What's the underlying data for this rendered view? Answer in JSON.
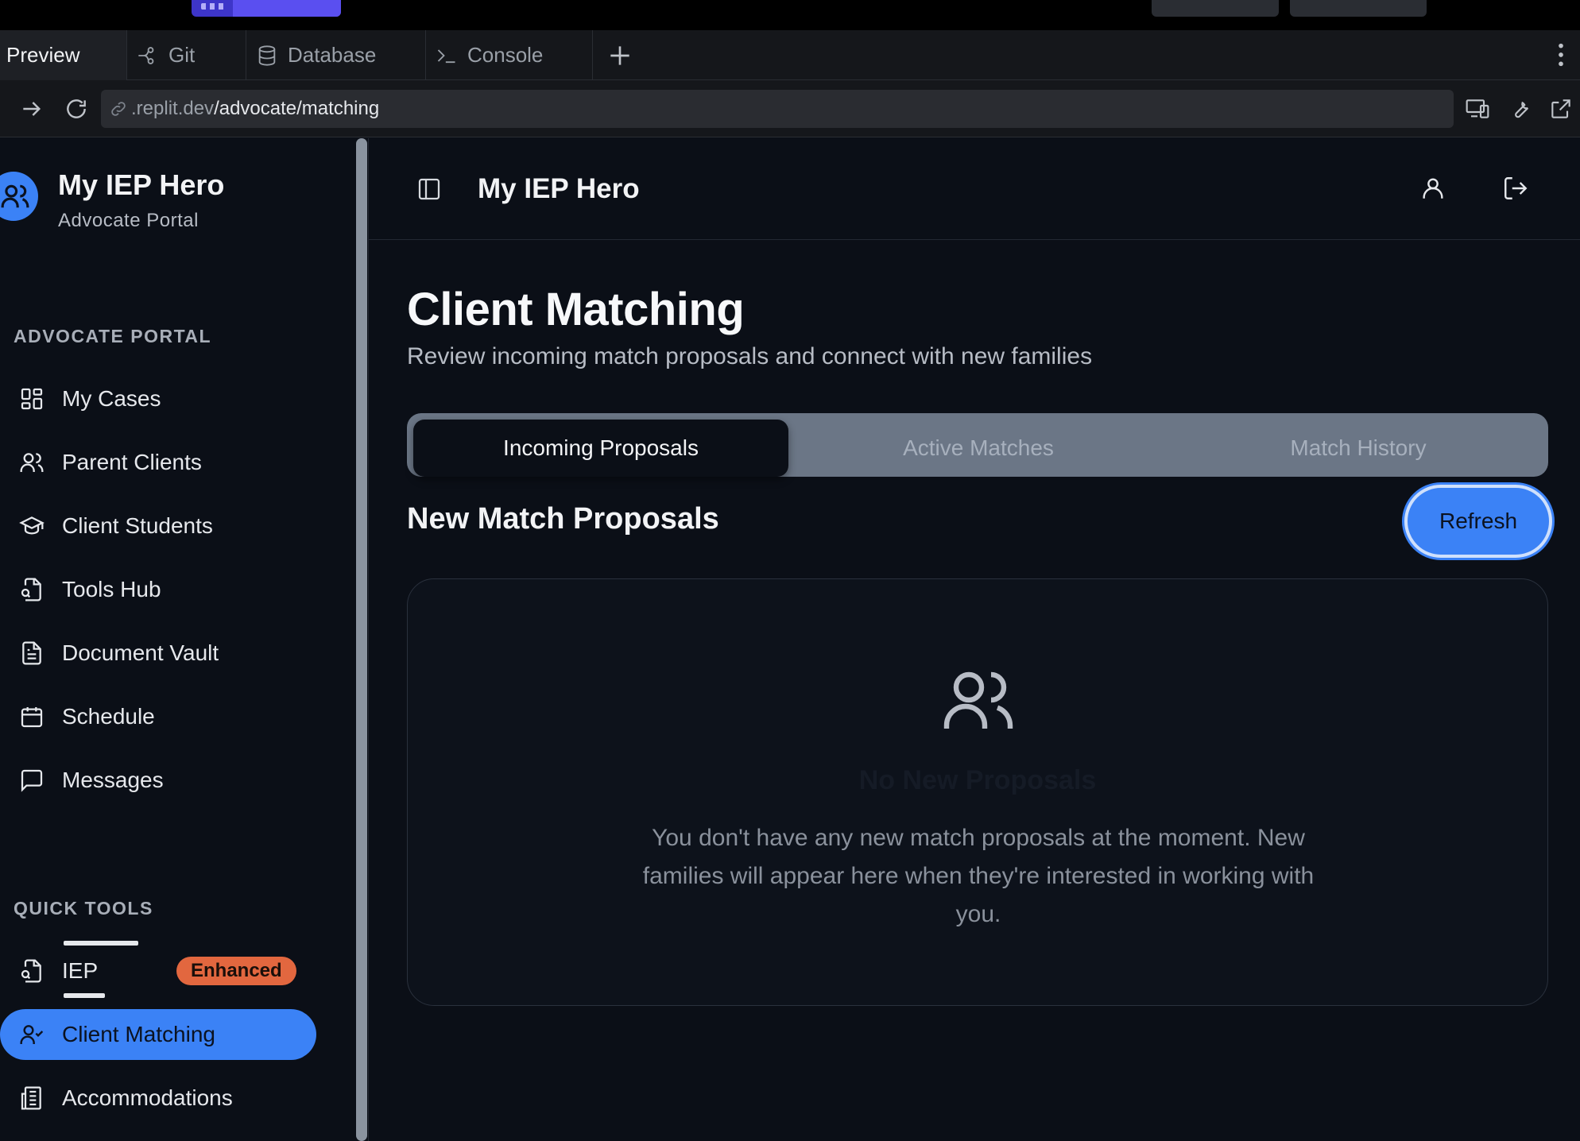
{
  "browser": {
    "tabs": [
      {
        "label": "Preview",
        "icon": "preview"
      },
      {
        "label": "Git",
        "icon": "git-icon"
      },
      {
        "label": "Database",
        "icon": "database-icon"
      },
      {
        "label": "Console",
        "icon": "console-icon"
      }
    ],
    "url_host": ".replit.dev",
    "url_path": "/advocate/matching"
  },
  "sidebar": {
    "brand_title": "My IEP Hero",
    "brand_subtitle": "Advocate Portal",
    "section_primary": "ADVOCATE PORTAL",
    "primary_items": [
      {
        "label": "My Cases",
        "icon": "layout-grid-icon"
      },
      {
        "label": "Parent Clients",
        "icon": "users-icon"
      },
      {
        "label": "Client Students",
        "icon": "graduation-cap-icon"
      },
      {
        "label": "Tools Hub",
        "icon": "file-search-icon"
      },
      {
        "label": "Document Vault",
        "icon": "file-text-icon"
      },
      {
        "label": "Schedule",
        "icon": "calendar-icon"
      },
      {
        "label": "Messages",
        "icon": "message-square-icon"
      }
    ],
    "section_tools": "QUICK TOOLS",
    "tool_items": [
      {
        "label": "IEP",
        "icon": "file-search-icon",
        "badge": "Enhanced"
      },
      {
        "label": "Client Matching",
        "icon": "user-check-icon",
        "active": true
      },
      {
        "label": "Accommodations",
        "icon": "building-icon"
      }
    ]
  },
  "header": {
    "title": "My IEP Hero"
  },
  "main": {
    "title": "Client Matching",
    "subtitle": "Review incoming match proposals and connect with new families",
    "tabs": [
      {
        "label": "Incoming Proposals",
        "active": true
      },
      {
        "label": "Active Matches",
        "active": false
      },
      {
        "label": "Match History",
        "active": false
      }
    ],
    "section_title": "New Match Proposals",
    "refresh_label": "Refresh",
    "empty_title": "No New Proposals",
    "empty_text": "You don't have any new match proposals at the moment. New families will appear here when they're interested in working with you."
  },
  "colors": {
    "accent": "#3b82f6",
    "badge": "#e2673f",
    "background": "#0b0f17"
  }
}
